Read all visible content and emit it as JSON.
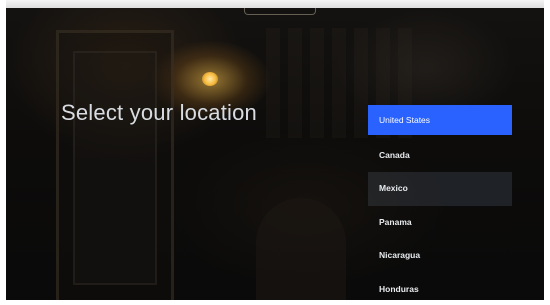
{
  "screen": {
    "title": "Select your location"
  },
  "locations": {
    "selected_index": 0,
    "items": [
      {
        "label": "United States"
      },
      {
        "label": "Canada"
      },
      {
        "label": "Mexico"
      },
      {
        "label": "Panama"
      },
      {
        "label": "Nicaragua"
      },
      {
        "label": "Honduras"
      }
    ]
  },
  "colors": {
    "selection": "#2962ff",
    "title_text": "#d9dde2",
    "item_text": "#e9ecef",
    "screen_background": "#0d0c0b"
  }
}
